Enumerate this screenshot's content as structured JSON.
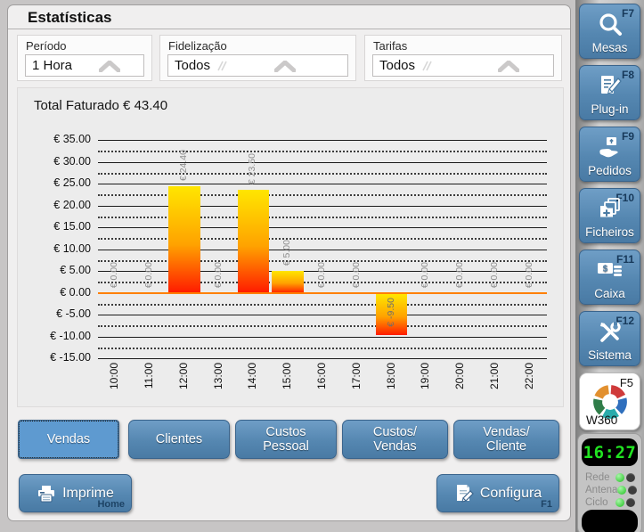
{
  "window": {
    "title": "Estatísticas"
  },
  "filters": [
    {
      "label": "Período",
      "value": "1 Hora"
    },
    {
      "label": "Fidelização",
      "value": "Todos"
    },
    {
      "label": "Tarifas",
      "value": "Todos"
    }
  ],
  "chart_data": {
    "type": "bar",
    "title": "Total Faturado € 43.40",
    "categories": [
      "10:00",
      "11:00",
      "12:00",
      "13:00",
      "14:00",
      "15:00",
      "16:00",
      "17:00",
      "18:00",
      "19:00",
      "20:00",
      "21:00",
      "22:00"
    ],
    "values": [
      0,
      0,
      24.4,
      0,
      23.5,
      5.0,
      0,
      0,
      -9.5,
      0,
      0,
      0,
      0
    ],
    "value_labels": [
      "€ 0.00",
      "€ 0.00",
      "€ 24.40",
      "€ 0.00",
      "€ 23.50",
      "€ 5.00",
      "€ 0.00",
      "€ 0.00",
      "€ -9.50",
      "€ 0.00",
      "€ 0.00",
      "€ 0.00",
      "€ 0.00"
    ],
    "ylim": [
      -15,
      35
    ],
    "ytick_step": 5,
    "yticks": [
      35,
      30,
      25,
      20,
      15,
      10,
      5,
      0,
      -5,
      -10,
      -15
    ],
    "ytick_labels": [
      "€ 35.00",
      "€ 30.00",
      "€ 25.00",
      "€ 20.00",
      "€ 15.00",
      "€ 10.00",
      "€ 5.00",
      "€ 0.00",
      "€ -5.00",
      "€ -10.00",
      "€ -15.00"
    ],
    "grid": "solid lines every 5, dotted lines every 2.5",
    "legend": "none",
    "zero_line_color": "#ff8000",
    "bar_gradient_top": "#ffe600",
    "bar_gradient_bottom": "#ff1c00"
  },
  "tabs": [
    {
      "lines": [
        "Vendas"
      ],
      "selected": true
    },
    {
      "lines": [
        "Clientes"
      ],
      "selected": false
    },
    {
      "lines": [
        "Custos",
        "Pessoal"
      ],
      "selected": false
    },
    {
      "lines": [
        "Custos/",
        "Vendas"
      ],
      "selected": false
    },
    {
      "lines": [
        "Vendas/",
        "Cliente"
      ],
      "selected": false
    }
  ],
  "actions": {
    "print": {
      "label": "Imprime",
      "shortcut": "Home"
    },
    "configure": {
      "label": "Configura",
      "shortcut": "F1"
    }
  },
  "sidebar": {
    "buttons": [
      {
        "label": "Mesas",
        "fkey": "F7",
        "icon": "search-icon"
      },
      {
        "label": "Plug-in",
        "fkey": "F8",
        "icon": "edit-note-icon"
      },
      {
        "label": "Pedidos",
        "fkey": "F9",
        "icon": "hand-package-icon"
      },
      {
        "label": "Ficheiros",
        "fkey": "F10",
        "icon": "folders-icon"
      },
      {
        "label": "Caixa",
        "fkey": "F11",
        "icon": "cash-icon"
      },
      {
        "label": "Sistema",
        "fkey": "F12",
        "icon": "tools-icon"
      }
    ],
    "w360": {
      "label": "W360",
      "fkey": "F5",
      "icon": "w360-ring-logo"
    },
    "clock": "16:27",
    "indicators": [
      {
        "label": "Rede",
        "led1": "on",
        "led2": "off"
      },
      {
        "label": "Antena",
        "led1": "on",
        "led2": "off"
      },
      {
        "label": "Ciclo",
        "led1": "on",
        "led2": "off"
      }
    ]
  },
  "colors": {
    "accent_blue": "#4e81ad",
    "selected_tab_blue": "#5e9ad0",
    "clock_green": "#21e421",
    "led_on_green": "#48d148",
    "zero_line_orange": "#ff8000",
    "bar_top_yellow": "#ffe600",
    "bar_bottom_red": "#ff1c00"
  }
}
